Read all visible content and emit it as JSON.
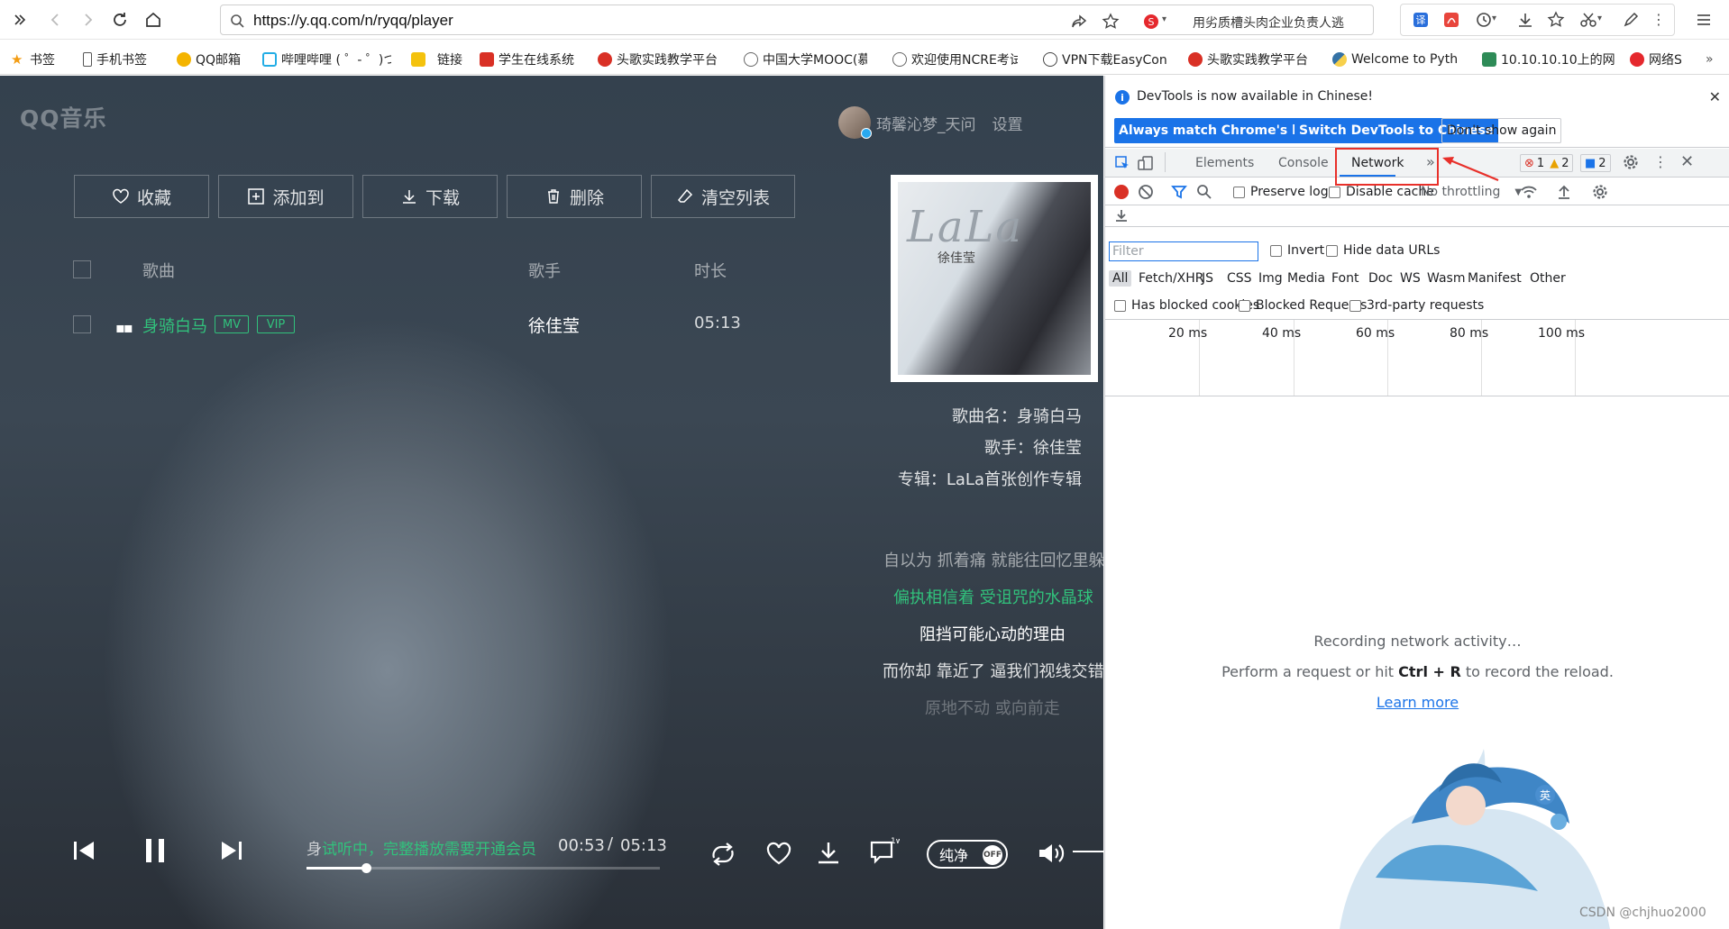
{
  "browser": {
    "url": "https://y.qq.com/n/ryqq/player",
    "news_text": "用劣质槽头肉企业负责人逃",
    "bookmarks": [
      {
        "label": "书签",
        "color": "#f39c12"
      },
      {
        "label": "手机书签",
        "color": "#555555"
      },
      {
        "label": "QQ邮箱",
        "color": "#f4b400"
      },
      {
        "label": "哔哩哔哩 ( ゜- ゜)つ",
        "color": "#23ade5"
      },
      {
        "label": "链接",
        "color": "#f4c20d"
      },
      {
        "label": "学生在线系统",
        "color": "#d93025"
      },
      {
        "label": "头歌实践教学平台",
        "color": "#d93025"
      },
      {
        "label": "中国大学MOOC(慕",
        "color": "#666666"
      },
      {
        "label": "欢迎使用NCRE考试",
        "color": "#666666"
      },
      {
        "label": "VPN下载EasyCon",
        "color": "#444444"
      },
      {
        "label": "头歌实践教学平台",
        "color": "#d93025"
      },
      {
        "label": "Welcome to Pyth",
        "color": "#3572a5"
      },
      {
        "label": "10.10.10.10上的网",
        "color": "#2e8b57"
      },
      {
        "label": "网络S",
        "color": "#e5282d"
      }
    ]
  },
  "player": {
    "logo": "QQ音乐",
    "username": "琦馨沁梦_天问",
    "settings": "设置",
    "actions": [
      "收藏",
      "添加到",
      "下载",
      "删除",
      "清空列表"
    ],
    "headers": {
      "song": "歌曲",
      "artist": "歌手",
      "duration": "时长"
    },
    "song": {
      "name": "身骑白马",
      "tag_mv": "MV",
      "tag_vip": "VIP",
      "artist": "徐佳莹",
      "duration": "05:13"
    },
    "cover": {
      "title": "LaLa",
      "artist_text": "徐佳莹"
    },
    "info": {
      "song": "歌曲名：身骑白马",
      "artist": "歌手：徐佳莹",
      "album": "专辑：LaLa首张创作专辑"
    },
    "lyrics": [
      "自以为 抓着痛 就能往回忆里躲",
      "偏执相信着 受诅咒的水晶球",
      "阻挡可能心动的理由",
      "而你却 靠近了 逼我们视线交错",
      "原地不动 或向前走"
    ],
    "progress": {
      "first_char": "身",
      "trial_text": "试听中，完整播放需要开通会员",
      "current": "00:53",
      "sep": "/",
      "total": "05:13",
      "fraction": 0.169
    },
    "pure_label": "纯净",
    "pure_state": "OFF",
    "accent": "#31c27c"
  },
  "devtools": {
    "banner_text": "DevTools is now available in Chinese!",
    "banner_buttons": [
      "Always match Chrome's language",
      "Switch DevTools to Chinese",
      "Don't show again"
    ],
    "tabs": [
      "Elements",
      "Console",
      "Network"
    ],
    "more_tabs": "»",
    "errors": "1",
    "warnings": "2",
    "messages": "2",
    "preserve_log": "Preserve log",
    "disable_cache": "Disable cache",
    "throttling": "No throttling",
    "filter_placeholder": "Filter",
    "invert": "Invert",
    "hide_data_urls": "Hide data URLs",
    "type_filters": [
      "All",
      "Fetch/XHR",
      "JS",
      "CSS",
      "Img",
      "Media",
      "Font",
      "Doc",
      "WS",
      "Wasm",
      "Manifest",
      "Other"
    ],
    "has_blocked_cookies": "Has blocked cookies",
    "blocked_requests": "Blocked Requests",
    "third_party": "3rd-party requests",
    "timeline_ticks": [
      "20 ms",
      "40 ms",
      "60 ms",
      "80 ms",
      "100 ms"
    ],
    "empty_line1": "Recording network activity…",
    "empty_line2_pre": "Perform a request or hit ",
    "empty_line2_keys": "Ctrl + R",
    "empty_line2_post": " to record the reload.",
    "learn_more": "Learn more"
  },
  "watermark": "CSDN @chjhuo2000"
}
